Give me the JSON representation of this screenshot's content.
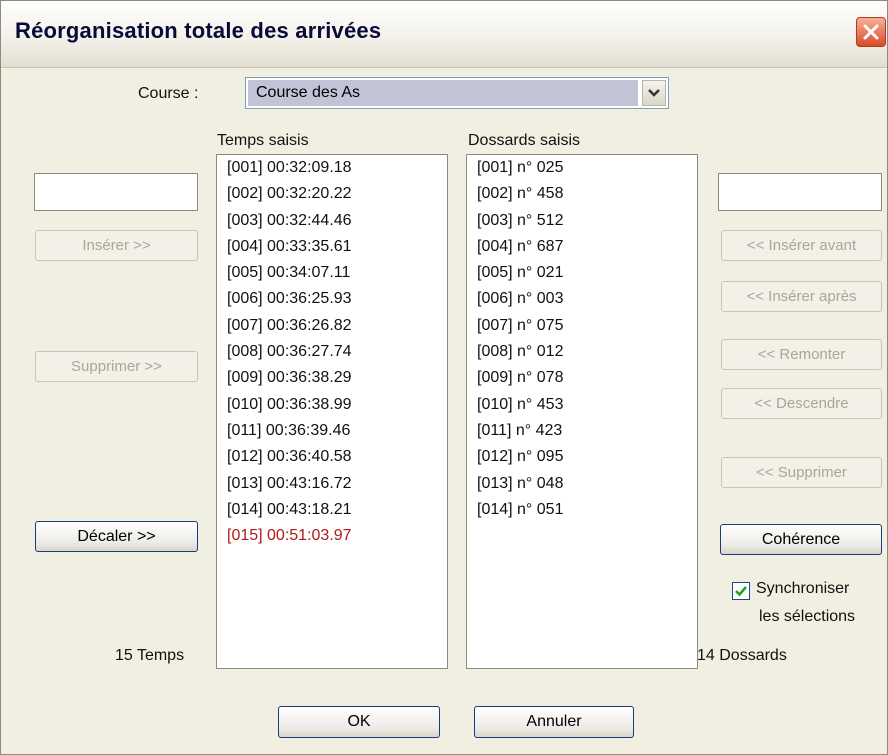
{
  "window": {
    "title": "Réorganisation totale des arrivées"
  },
  "course": {
    "label": "Course :",
    "selected": "Course des As"
  },
  "temps": {
    "header": "Temps saisis",
    "items": [
      "[001]  00:32:09.18",
      "[002]  00:32:20.22",
      "[003]  00:32:44.46",
      "[004]  00:33:35.61",
      "[005]  00:34:07.11",
      "[006]  00:36:25.93",
      "[007]  00:36:26.82",
      "[008]  00:36:27.74",
      "[009]  00:36:38.29",
      "[010]  00:36:38.99",
      "[011]  00:36:39.46",
      "[012]  00:36:40.58",
      "[013]  00:43:16.72",
      "[014]  00:43:18.21",
      "[015]  00:51:03.97"
    ],
    "highlight_color": "#b21818",
    "count_label": "15 Temps"
  },
  "dossards": {
    "header": "Dossards saisis",
    "items": [
      "[001] n° 025",
      "[002] n° 458",
      "[003] n° 512",
      "[004] n° 687",
      "[005] n° 021",
      "[006] n° 003",
      "[007] n° 075",
      "[008] n° 012",
      "[009] n° 078",
      "[010] n° 453",
      "[011] n° 423",
      "[012] n° 095",
      "[013] n° 048",
      "[014] n° 051"
    ],
    "count_label": "14 Dossards"
  },
  "left_buttons": {
    "inserer": "Insérer >>",
    "supprimer": "Supprimer >>",
    "decaler": "Décaler >>"
  },
  "right_buttons": {
    "inserer_avant": "<< Insérer avant",
    "inserer_apres": "<< Insérer après",
    "remonter": "<< Remonter",
    "descendre": "<< Descendre",
    "supprimer": "<< Supprimer",
    "coherence": "Cohérence"
  },
  "sync": {
    "line1": "Synchroniser",
    "line2": "les sélections",
    "checked": true
  },
  "footer": {
    "ok": "OK",
    "annuler": "Annuler"
  }
}
